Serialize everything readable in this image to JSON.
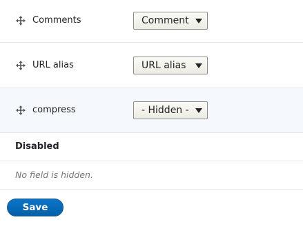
{
  "fields": [
    {
      "label": "Comments",
      "selected": "Comment"
    },
    {
      "label": "URL alias",
      "selected": "URL alias"
    },
    {
      "label": "compress",
      "selected": "- Hidden -"
    }
  ],
  "disabled_region": {
    "heading": "Disabled",
    "empty_message": "No field is hidden."
  },
  "actions": {
    "save_label": "Save"
  },
  "icons": {
    "drag_handle": "move-arrows-icon",
    "select_arrow": "triangle-down-icon"
  },
  "colors": {
    "primary_button": "#0a74c8",
    "highlight_row": "#f5f9fd"
  }
}
